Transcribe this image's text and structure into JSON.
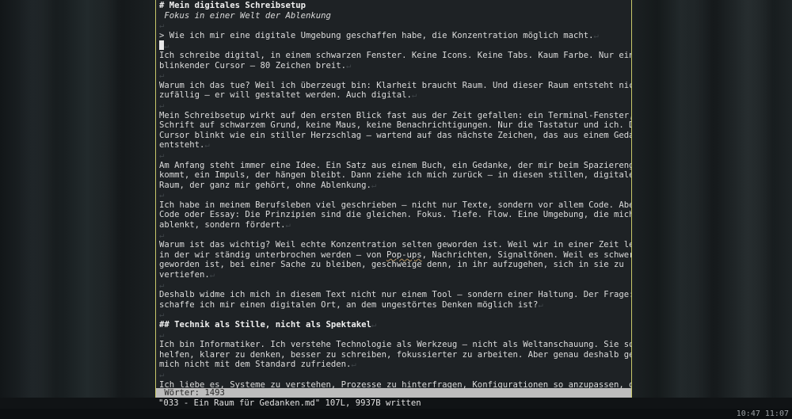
{
  "lines": [
    {
      "text": "# Mein digitales Schreibsetup",
      "style": "h"
    },
    {
      "text": " Fokus in einer Welt der Ablenkung",
      "style": "it"
    },
    {
      "text": "",
      "style": "ret"
    },
    {
      "text": "> Wie ich mir eine digitale Umgebung geschaffen habe, die Konzentration möglich macht.",
      "style": "ret"
    },
    {
      "text": "",
      "style": "cursor"
    },
    {
      "text": "Ich schreibe digital, in einem schwarzen Fenster. Keine Icons. Keine Tabs. Kaum Farbe. Nur ein",
      "style": ""
    },
    {
      "text": "blinkender Cursor – 80 Zeichen breit.",
      "style": "ret"
    },
    {
      "text": "",
      "style": "ret"
    },
    {
      "text": "Warum ich das tue? Weil ich überzeugt bin: Klarheit braucht Raum. Und dieser Raum entsteht nicht",
      "style": ""
    },
    {
      "text": "zufällig – er will gestaltet werden. Auch digital.",
      "style": "ret"
    },
    {
      "text": "",
      "style": "ret"
    },
    {
      "text": "Mein Schreibsetup wirkt auf den ersten Blick fast aus der Zeit gefallen: ein Terminal-Fenster, weiße",
      "style": ""
    },
    {
      "text": "Schrift auf schwarzem Grund, keine Maus, keine Benachrichtigungen. Nur die Tastatur und ich. Der",
      "style": ""
    },
    {
      "text": "Cursor blinkt wie ein stiller Herzschlag – wartend auf das nächste Zeichen, das aus einem Gedanken",
      "style": ""
    },
    {
      "text": "entsteht.",
      "style": "ret"
    },
    {
      "text": "",
      "style": "ret"
    },
    {
      "text": "Am Anfang steht immer eine Idee. Ein Satz aus einem Buch, ein Gedanke, der mir beim Spazierengehen",
      "style": ""
    },
    {
      "text": "kommt, ein Impuls, der hängen bleibt. Dann ziehe ich mich zurück – in diesen stillen, digitalen",
      "style": ""
    },
    {
      "text": "Raum, der ganz mir gehört, ohne Ablenkung.",
      "style": "ret"
    },
    {
      "text": "",
      "style": "ret"
    },
    {
      "text": "Ich habe in meinem Berufsleben viel geschrieben – nicht nur Texte, sondern vor allem Code. Aber ob",
      "style": ""
    },
    {
      "text": "Code oder Essay: Die Prinzipien sind die gleichen. Fokus. Tiefe. Flow. Eine Umgebung, die mich nicht",
      "style": ""
    },
    {
      "text": "ablenkt, sondern fördert.",
      "style": "ret"
    },
    {
      "text": "",
      "style": "ret"
    },
    {
      "text": "Warum ist das wichtig? Weil echte Konzentration selten geworden ist. Weil wir in einer Zeit leben,",
      "style": ""
    },
    {
      "text": "in der wir ständig unterbrochen werden – von Pop-ups, Nachrichten, Signaltönen. Weil es schwer",
      "style": "spell"
    },
    {
      "text": "geworden ist, bei einer Sache zu bleiben, geschweige denn, in ihr aufzugehen, sich in sie zu",
      "style": ""
    },
    {
      "text": "vertiefen.",
      "style": "ret"
    },
    {
      "text": "",
      "style": "ret"
    },
    {
      "text": "Deshalb widme ich mich in diesem Text nicht nur einem Tool – sondern einer Haltung. Der Frage: Wie",
      "style": ""
    },
    {
      "text": "schaffe ich mir einen digitalen Ort, an dem ungestörtes Denken möglich ist?",
      "style": "ret"
    },
    {
      "text": "",
      "style": "ret"
    },
    {
      "text": "## Technik als Stille, nicht als Spektakel",
      "style": "hret"
    },
    {
      "text": "",
      "style": "ret"
    },
    {
      "text": "Ich bin Informatiker. Ich verstehe Technologie als Werkzeug – nicht als Weltanschauung. Sie soll mir",
      "style": ""
    },
    {
      "text": "helfen, klarer zu denken, besser zu schreiben, fokussierter zu arbeiten. Aber genau deshalb gebe ich",
      "style": ""
    },
    {
      "text": "mich nicht mit dem Standard zufrieden.",
      "style": "ret"
    },
    {
      "text": "",
      "style": "ret"
    },
    {
      "text": "Ich liebe es, Systeme zu verstehen, Prozesse zu hinterfragen, Konfigurationen so anzupassen, dass",
      "style": "trail"
    }
  ],
  "trail_marker": "@@@",
  "word_count": " Wörter: 1493",
  "command_line": "\"033 - Ein Raum für Gedanken.md\" 107L, 9937B written",
  "clock": "10:47  11:07"
}
